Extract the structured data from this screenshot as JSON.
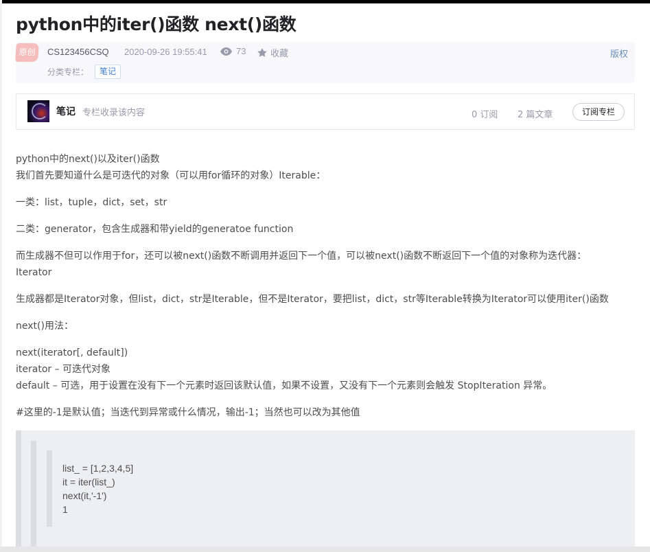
{
  "article": {
    "title": "python中的iter()函数 next()函数",
    "original_badge": "原创",
    "author": "CS123456CSQ",
    "date": "2020-09-26 19:55:41",
    "views": "73",
    "favorite_label": "收藏",
    "copyright_label": "版权",
    "category_label": "分类专栏：",
    "category_tag": "笔记"
  },
  "column": {
    "name": "笔记",
    "description": "专栏收录该内容",
    "subscribers": "0 订阅",
    "articles": "2 篇文章",
    "subscribe_button": "订阅专栏"
  },
  "content": {
    "p1_line1": "python中的next()以及iter()函数",
    "p1_line2": "我们首先要知道什么是可迭代的对象（可以用for循环的对象）Iterable：",
    "p2": "一类：list，tuple，dict，set，str",
    "p3": "二类：generator，包含生成器和带yield的generatoe function",
    "p4_line1": "而生成器不但可以作用于for，还可以被next()函数不断调用并返回下一个值，可以被next()函数不断返回下一个值的对象称为迭代器：",
    "p4_line2": "Iterator",
    "p5": "生成器都是Iterator对象，但list，dict，str是Iterable，但不是Iterator，要把list，dict，str等Iterable转换为Iterator可以使用iter()函数",
    "p6": "next()用法：",
    "p7_line1": "next(iterator[, default])",
    "p7_line2": "iterator – 可迭代对象",
    "p7_line3": "default – 可选，用于设置在没有下一个元素时返回该默认值，如果不设置，又没有下一个元素则会触发 StopIteration 异常。",
    "p8": "#这里的-1是默认值；当迭代到异常或什么情况，输出-1；当然也可以改为其他值",
    "code_lines": [
      "list_ = [1,2,3,4,5]",
      "it = iter(list_)",
      "next(it,'-1')",
      "1"
    ]
  },
  "icons": {
    "views": "eye-icon",
    "favorite": "star-icon"
  },
  "colors": {
    "badge_bg": "#f6bdbd",
    "link_blue": "#3d7bd4",
    "meta_bg": "#f7f7fc",
    "code_bg": "#eeeff2"
  }
}
